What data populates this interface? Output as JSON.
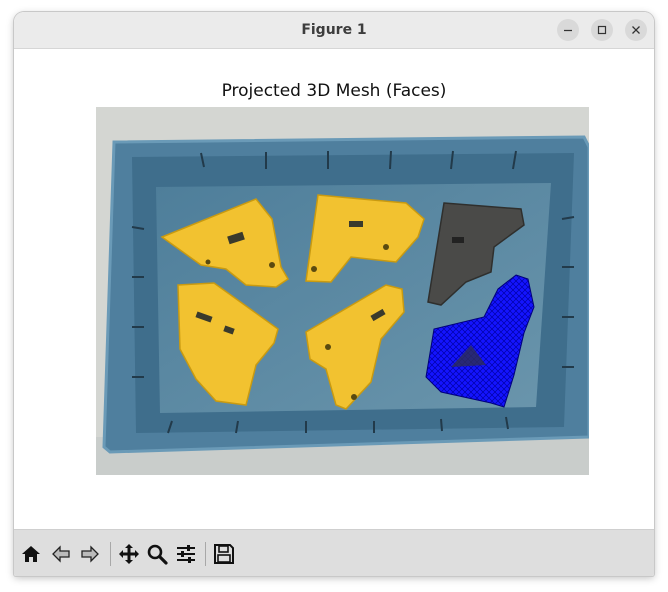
{
  "window": {
    "title": "Figure 1",
    "controls": [
      "minimize",
      "maximize",
      "close"
    ]
  },
  "figure": {
    "plot_title": "Projected 3D Mesh (Faces)",
    "image_content": "Photo of a blue plastic tray holding four yellow 3D-printed brackets, one dark gray bracket and one bracket overlaid with a blue projected mesh"
  },
  "toolbar": {
    "items": [
      "home",
      "back",
      "forward",
      "pan",
      "zoom",
      "configure-subplots",
      "save"
    ]
  },
  "colors": {
    "titlebar": "#ebebeb",
    "toolbar": "#dedede",
    "mesh_overlay": "#0000ff",
    "bracket_yellow": "#f1c232",
    "tray_blue": "#5a8aa8"
  }
}
